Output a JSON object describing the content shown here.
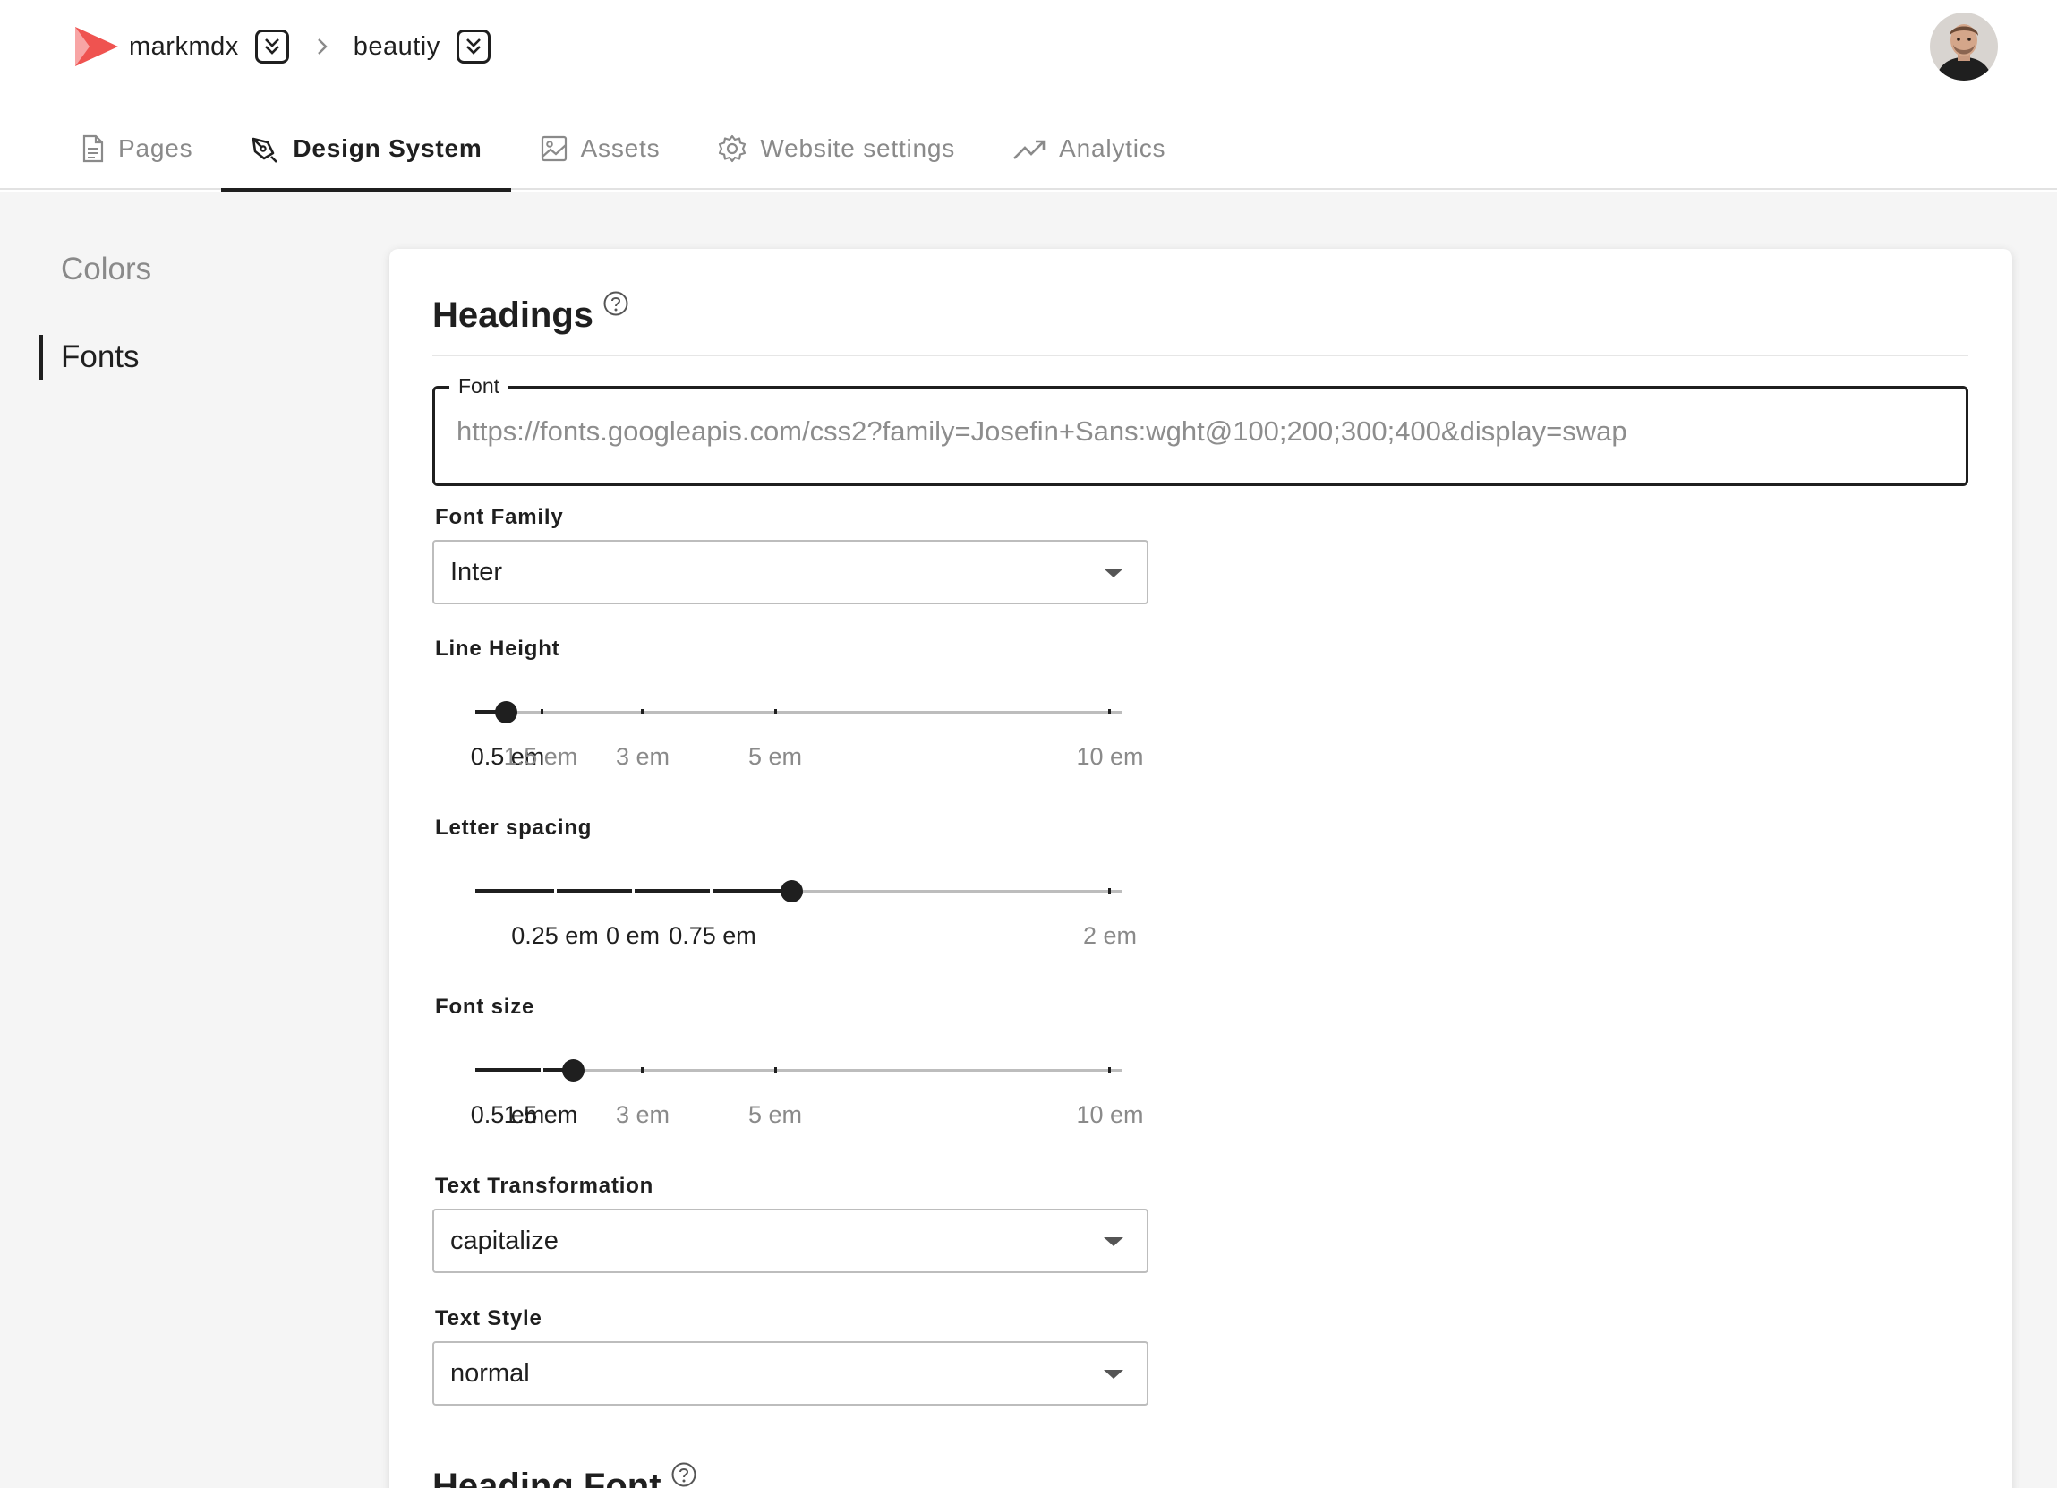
{
  "breadcrumb": {
    "org": "markmdx",
    "project": "beautiy"
  },
  "brand_color": "#ef5350",
  "tabs": [
    {
      "label": "Pages",
      "icon": "file-icon"
    },
    {
      "label": "Design System",
      "icon": "pen-tool-icon",
      "active": true
    },
    {
      "label": "Assets",
      "icon": "image-icon"
    },
    {
      "label": "Website settings",
      "icon": "gear-icon"
    },
    {
      "label": "Analytics",
      "icon": "trending-up-icon"
    }
  ],
  "sidebar": {
    "items": [
      {
        "label": "Colors"
      },
      {
        "label": "Fonts",
        "active": true
      }
    ]
  },
  "headings": {
    "title": "Headings",
    "font_label": "Font",
    "font_placeholder": "https://fonts.googleapis.com/css2?family=Josefin+Sans:wght@100;200;300;400&display=swap",
    "font_family": {
      "label": "Font Family",
      "value": "Inter"
    },
    "line_height": {
      "label": "Line Height",
      "value": 0.5,
      "unit": "em",
      "marks": [
        "0.5 em",
        "1.5 em",
        "3 em",
        "5 em",
        "10 em"
      ]
    },
    "letter_spacing": {
      "label": "Letter spacing",
      "value": 0.75,
      "unit": "em",
      "marks": [
        "0.25 em",
        "0 em",
        "0.75 em",
        "2 em"
      ]
    },
    "font_size": {
      "label": "Font size",
      "value": 1.5,
      "unit": "em",
      "marks": [
        "0.5 em",
        "1.5 em",
        "3 em",
        "5 em",
        "10 em"
      ]
    },
    "text_transformation": {
      "label": "Text Transformation",
      "value": "capitalize"
    },
    "text_style": {
      "label": "Text Style",
      "value": "normal"
    }
  },
  "next_section": {
    "title": "Heading Font"
  }
}
